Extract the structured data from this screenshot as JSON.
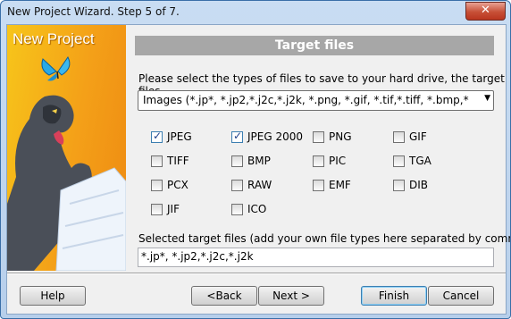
{
  "window": {
    "title": "New Project Wizard. Step 5 of 7.",
    "close_label": "✕"
  },
  "side": {
    "title": "New Project"
  },
  "panel": {
    "heading": "Target files",
    "prompt": "Please select the types of files to save to your hard drive, the target files.",
    "filter_select": "Images (*.jp*, *.jp2,*.j2c,*.j2k, *.png, *.gif, *.tif,*.tiff, *.bmp,*.wbmp, *.pic",
    "checkboxes": [
      {
        "label": "JPEG",
        "checked": true
      },
      {
        "label": "JPEG 2000",
        "checked": true
      },
      {
        "label": "PNG",
        "checked": false
      },
      {
        "label": "GIF",
        "checked": false
      },
      {
        "label": "TIFF",
        "checked": false
      },
      {
        "label": "BMP",
        "checked": false
      },
      {
        "label": "PIC",
        "checked": false
      },
      {
        "label": "TGA",
        "checked": false
      },
      {
        "label": "PCX",
        "checked": false
      },
      {
        "label": "RAW",
        "checked": false
      },
      {
        "label": "EMF",
        "checked": false
      },
      {
        "label": "DIB",
        "checked": false
      },
      {
        "label": "JIF",
        "checked": false
      },
      {
        "label": "ICO",
        "checked": false
      }
    ],
    "selected_label": "Selected target files (add your own file types here separated by commas)",
    "selected_value": "*.jp*, *.jp2,*.j2c,*.j2k"
  },
  "buttons": {
    "help": "Help",
    "back": "<Back",
    "next": "Next >",
    "finish": "Finish",
    "cancel": "Cancel"
  },
  "colors": {
    "heading_bg": "#a7a7a7",
    "side_gradient": "#f4a018",
    "close_red": "#c75037"
  }
}
